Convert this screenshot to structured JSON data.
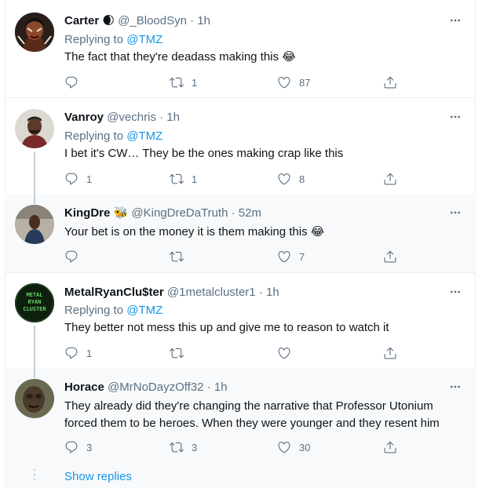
{
  "tweets": [
    {
      "name": "Carter",
      "name_emoji": "🌒",
      "handle": "@_BloodSyn",
      "time": "1h",
      "reply_prefix": "Replying to",
      "reply_to": "@TMZ",
      "text": "The fact that they're deadass making this",
      "text_emoji": "😂",
      "replies": "",
      "retweets": "1",
      "likes": "87"
    },
    {
      "name": "Vanroy",
      "handle": "@vechris",
      "time": "1h",
      "reply_prefix": "Replying to",
      "reply_to": "@TMZ",
      "text": "I bet it's CW… They be the ones making crap like this",
      "replies": "1",
      "retweets": "1",
      "likes": "8"
    },
    {
      "name": "KingDre",
      "name_emoji": "🐝",
      "handle": "@KingDreDaTruth",
      "time": "52m",
      "text": "Your bet is on the money it is them making this",
      "text_emoji": "😂",
      "replies": "",
      "retweets": "",
      "likes": "7"
    },
    {
      "name": "MetalRyanClu$ter",
      "handle": "@1metalcluster1",
      "time": "1h",
      "reply_prefix": "Replying to",
      "reply_to": "@TMZ",
      "text": "They better not mess this up and give me to reason to watch it",
      "replies": "1",
      "retweets": "",
      "likes": "",
      "avatar_text": [
        "METAL",
        "RYAN",
        "CLUSTER"
      ]
    },
    {
      "name": "Horace",
      "handle": "@MrNoDayzOff32",
      "time": "1h",
      "text_line1": "They already did they're changing the narrative that Professor Utonium",
      "text_line2": "forced them to be heroes. When they were younger and they resent him",
      "replies": "3",
      "retweets": "3",
      "likes": "30"
    }
  ],
  "sep": " · ",
  "show_replies": "Show replies",
  "colors": {
    "accent": "#1b95e0",
    "muted": "#5b7083",
    "alt_bg": "#f7f9fa",
    "divider": "#ebeef0"
  },
  "icons": [
    "reply-icon",
    "retweet-icon",
    "like-icon",
    "share-icon",
    "more-icon"
  ]
}
